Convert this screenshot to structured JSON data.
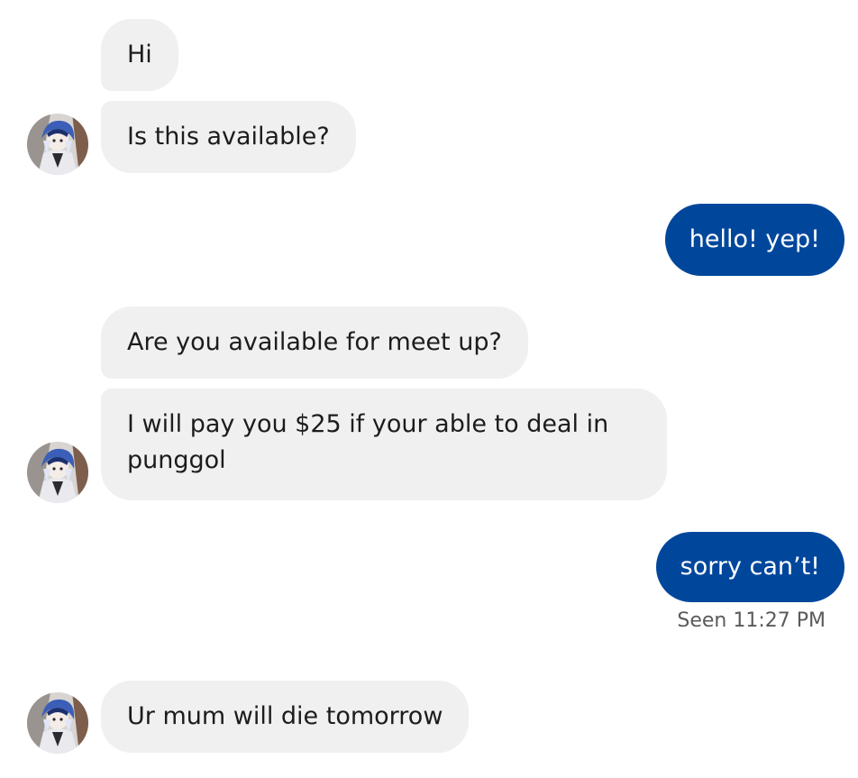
{
  "conversation": {
    "messages": [
      {
        "sender": "them",
        "text": "Hi"
      },
      {
        "sender": "them",
        "text": "Is this available?"
      },
      {
        "sender": "me",
        "text": "hello! yep!"
      },
      {
        "sender": "them",
        "text": "Are you available for meet up?"
      },
      {
        "sender": "them",
        "text": "I will pay you $25 if your able to deal in punggol"
      },
      {
        "sender": "me",
        "text": "sorry can’t!"
      },
      {
        "sender": "them",
        "text": "Ur mum will die tomorrow"
      }
    ],
    "receipt": "Seen 11:27 PM"
  },
  "colors": {
    "incoming_bubble": "#f0f0f0",
    "outgoing_bubble": "#00479c",
    "background": "#ffffff"
  },
  "icons": {
    "contact_avatar": "avatar"
  }
}
